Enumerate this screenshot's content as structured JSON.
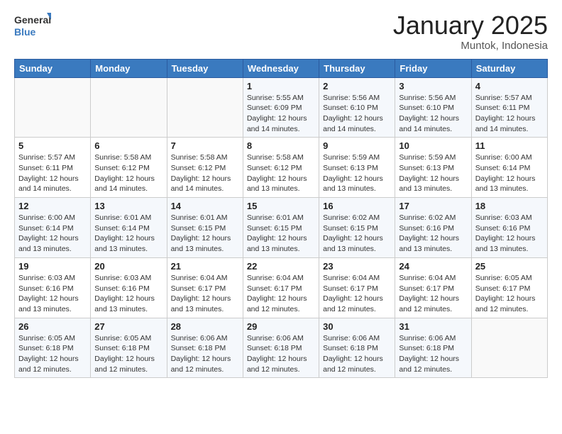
{
  "logo": {
    "general": "General",
    "blue": "Blue"
  },
  "header": {
    "month": "January 2025",
    "location": "Muntok, Indonesia"
  },
  "days_of_week": [
    "Sunday",
    "Monday",
    "Tuesday",
    "Wednesday",
    "Thursday",
    "Friday",
    "Saturday"
  ],
  "weeks": [
    [
      {
        "day": "",
        "info": ""
      },
      {
        "day": "",
        "info": ""
      },
      {
        "day": "",
        "info": ""
      },
      {
        "day": "1",
        "info": "Sunrise: 5:55 AM\nSunset: 6:09 PM\nDaylight: 12 hours and 14 minutes."
      },
      {
        "day": "2",
        "info": "Sunrise: 5:56 AM\nSunset: 6:10 PM\nDaylight: 12 hours and 14 minutes."
      },
      {
        "day": "3",
        "info": "Sunrise: 5:56 AM\nSunset: 6:10 PM\nDaylight: 12 hours and 14 minutes."
      },
      {
        "day": "4",
        "info": "Sunrise: 5:57 AM\nSunset: 6:11 PM\nDaylight: 12 hours and 14 minutes."
      }
    ],
    [
      {
        "day": "5",
        "info": "Sunrise: 5:57 AM\nSunset: 6:11 PM\nDaylight: 12 hours and 14 minutes."
      },
      {
        "day": "6",
        "info": "Sunrise: 5:58 AM\nSunset: 6:12 PM\nDaylight: 12 hours and 14 minutes."
      },
      {
        "day": "7",
        "info": "Sunrise: 5:58 AM\nSunset: 6:12 PM\nDaylight: 12 hours and 14 minutes."
      },
      {
        "day": "8",
        "info": "Sunrise: 5:58 AM\nSunset: 6:12 PM\nDaylight: 12 hours and 13 minutes."
      },
      {
        "day": "9",
        "info": "Sunrise: 5:59 AM\nSunset: 6:13 PM\nDaylight: 12 hours and 13 minutes."
      },
      {
        "day": "10",
        "info": "Sunrise: 5:59 AM\nSunset: 6:13 PM\nDaylight: 12 hours and 13 minutes."
      },
      {
        "day": "11",
        "info": "Sunrise: 6:00 AM\nSunset: 6:14 PM\nDaylight: 12 hours and 13 minutes."
      }
    ],
    [
      {
        "day": "12",
        "info": "Sunrise: 6:00 AM\nSunset: 6:14 PM\nDaylight: 12 hours and 13 minutes."
      },
      {
        "day": "13",
        "info": "Sunrise: 6:01 AM\nSunset: 6:14 PM\nDaylight: 12 hours and 13 minutes."
      },
      {
        "day": "14",
        "info": "Sunrise: 6:01 AM\nSunset: 6:15 PM\nDaylight: 12 hours and 13 minutes."
      },
      {
        "day": "15",
        "info": "Sunrise: 6:01 AM\nSunset: 6:15 PM\nDaylight: 12 hours and 13 minutes."
      },
      {
        "day": "16",
        "info": "Sunrise: 6:02 AM\nSunset: 6:15 PM\nDaylight: 12 hours and 13 minutes."
      },
      {
        "day": "17",
        "info": "Sunrise: 6:02 AM\nSunset: 6:16 PM\nDaylight: 12 hours and 13 minutes."
      },
      {
        "day": "18",
        "info": "Sunrise: 6:03 AM\nSunset: 6:16 PM\nDaylight: 12 hours and 13 minutes."
      }
    ],
    [
      {
        "day": "19",
        "info": "Sunrise: 6:03 AM\nSunset: 6:16 PM\nDaylight: 12 hours and 13 minutes."
      },
      {
        "day": "20",
        "info": "Sunrise: 6:03 AM\nSunset: 6:16 PM\nDaylight: 12 hours and 13 minutes."
      },
      {
        "day": "21",
        "info": "Sunrise: 6:04 AM\nSunset: 6:17 PM\nDaylight: 12 hours and 13 minutes."
      },
      {
        "day": "22",
        "info": "Sunrise: 6:04 AM\nSunset: 6:17 PM\nDaylight: 12 hours and 12 minutes."
      },
      {
        "day": "23",
        "info": "Sunrise: 6:04 AM\nSunset: 6:17 PM\nDaylight: 12 hours and 12 minutes."
      },
      {
        "day": "24",
        "info": "Sunrise: 6:04 AM\nSunset: 6:17 PM\nDaylight: 12 hours and 12 minutes."
      },
      {
        "day": "25",
        "info": "Sunrise: 6:05 AM\nSunset: 6:17 PM\nDaylight: 12 hours and 12 minutes."
      }
    ],
    [
      {
        "day": "26",
        "info": "Sunrise: 6:05 AM\nSunset: 6:18 PM\nDaylight: 12 hours and 12 minutes."
      },
      {
        "day": "27",
        "info": "Sunrise: 6:05 AM\nSunset: 6:18 PM\nDaylight: 12 hours and 12 minutes."
      },
      {
        "day": "28",
        "info": "Sunrise: 6:06 AM\nSunset: 6:18 PM\nDaylight: 12 hours and 12 minutes."
      },
      {
        "day": "29",
        "info": "Sunrise: 6:06 AM\nSunset: 6:18 PM\nDaylight: 12 hours and 12 minutes."
      },
      {
        "day": "30",
        "info": "Sunrise: 6:06 AM\nSunset: 6:18 PM\nDaylight: 12 hours and 12 minutes."
      },
      {
        "day": "31",
        "info": "Sunrise: 6:06 AM\nSunset: 6:18 PM\nDaylight: 12 hours and 12 minutes."
      },
      {
        "day": "",
        "info": ""
      }
    ]
  ]
}
